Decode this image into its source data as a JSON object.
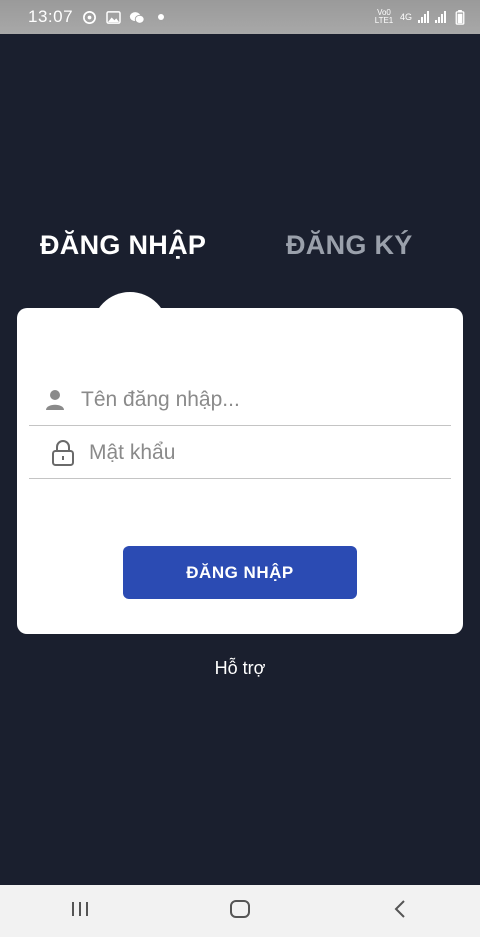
{
  "status_bar": {
    "time": "13:07",
    "network_label_top": "Vo0",
    "network_label_bottom": "LTE1",
    "network_type": "4G"
  },
  "tabs": {
    "login_label": "ĐĂNG NHẬP",
    "register_label": "ĐĂNG KÝ",
    "active": "login"
  },
  "form": {
    "username_placeholder": "Tên đăng nhập...",
    "password_placeholder": "Mật khẩu",
    "username_value": "",
    "password_value": "",
    "submit_label": "ĐĂNG NHẬP"
  },
  "support": {
    "label": "Hỗ trợ"
  },
  "colors": {
    "background": "#1a1f2e",
    "primary_button": "#2b4bb3",
    "inactive_tab": "#9aa0ab",
    "card": "#ffffff"
  },
  "icons": {
    "status": [
      "whatsapp-icon",
      "gallery-icon",
      "messenger-icon",
      "dot-icon"
    ],
    "status_right": [
      "signal-icon",
      "signal-icon",
      "signal-icon",
      "battery-icon"
    ],
    "fields": [
      "user-icon",
      "lock-icon"
    ],
    "nav": [
      "recent-apps-icon",
      "home-icon",
      "back-icon"
    ]
  }
}
